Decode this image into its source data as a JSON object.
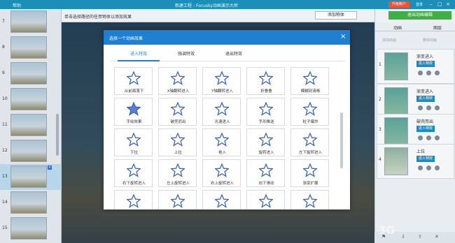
{
  "titlebar": {
    "menu_label": "帮助",
    "title": "新建工程 - Focusky动画演示大师",
    "upgrade_label": "升级账户",
    "login_label": "登录"
  },
  "toolbar": {
    "hint": "单击选择路径的任意物体以添加效果",
    "add_object_label": "添加物体"
  },
  "slides": [
    {
      "num": "7"
    },
    {
      "num": "8"
    },
    {
      "num": "9"
    },
    {
      "num": "10"
    },
    {
      "num": "11"
    },
    {
      "num": "12"
    },
    {
      "num": "13"
    },
    {
      "num": "14"
    },
    {
      "num": "15"
    }
  ],
  "right_panel": {
    "exit_edit_label": "退出动画编辑",
    "tabs": [
      "动画",
      "图层"
    ],
    "add_animation_label": "添加动画",
    "delete_animation_label": "删除动画",
    "items": [
      {
        "index": "1",
        "name": "渐变进入",
        "effect": "进入特效"
      },
      {
        "index": "2",
        "name": "渐变进入",
        "effect": "进入特效"
      },
      {
        "index": "3",
        "name": "破壳而出",
        "effect": "进入特效"
      },
      {
        "index": "4",
        "name": "上拉",
        "effect": "进入特效"
      }
    ]
  },
  "dialog": {
    "title": "选择一个动画效果",
    "tabs": [
      {
        "label": "进入特效",
        "active": true
      },
      {
        "label": "强调特效",
        "active": false
      },
      {
        "label": "退出特效",
        "active": false
      }
    ],
    "effects": [
      {
        "label": "从前面落下"
      },
      {
        "label": "X轴翻转进入"
      },
      {
        "label": "Y轴翻转进入"
      },
      {
        "label": "折叠叠"
      },
      {
        "label": "模糊到清晰"
      },
      {
        "label": "手绘效果"
      },
      {
        "label": "破壳而出"
      },
      {
        "label": "光速进入"
      },
      {
        "label": "手形推送"
      },
      {
        "label": "粒子爆炸"
      },
      {
        "label": "下拉"
      },
      {
        "label": "上拉"
      },
      {
        "label": "卷入"
      },
      {
        "label": "旋转进入"
      },
      {
        "label": "左下旋转进入"
      },
      {
        "label": "右下旋转进入"
      },
      {
        "label": "左上旋转进入"
      },
      {
        "label": "右上旋转进入"
      },
      {
        "label": "向下滑动"
      },
      {
        "label": "渐变扩展"
      },
      {
        "label": ""
      },
      {
        "label": ""
      },
      {
        "label": ""
      },
      {
        "label": ""
      },
      {
        "label": ""
      }
    ],
    "accent_color": "#1f7fd0"
  }
}
